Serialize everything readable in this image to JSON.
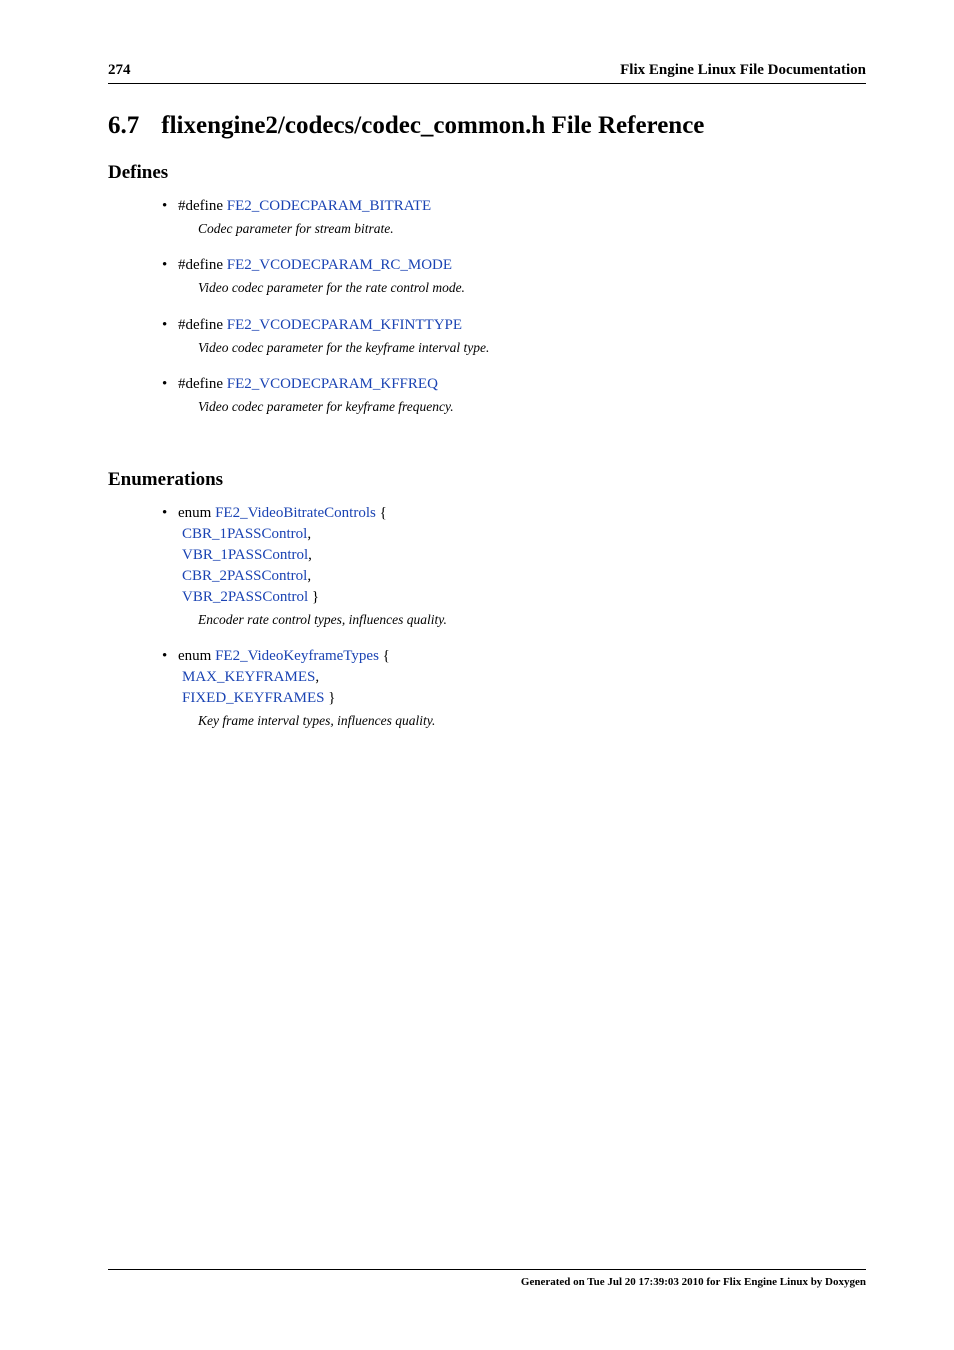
{
  "header": {
    "page_number": "274",
    "title": "Flix Engine Linux File Documentation"
  },
  "section": {
    "number": "6.7",
    "title": "flixengine2/codecs/codec_common.h File Reference"
  },
  "defines": {
    "heading": "Defines",
    "keyword": "#define",
    "items": [
      {
        "name": "FE2_CODECPARAM_BITRATE",
        "desc": "Codec parameter for stream bitrate."
      },
      {
        "name": "FE2_VCODECPARAM_RC_MODE",
        "desc": "Video codec parameter for the rate control mode."
      },
      {
        "name": "FE2_VCODECPARAM_KFINTTYPE",
        "desc": "Video codec parameter for the keyframe interval type."
      },
      {
        "name": "FE2_VCODECPARAM_KFFREQ",
        "desc": "Video codec parameter for keyframe frequency."
      }
    ]
  },
  "enums": {
    "heading": "Enumerations",
    "keyword": "enum",
    "items": [
      {
        "name": "FE2_VideoBitrateControls",
        "open": "{",
        "close": "}",
        "sep": ",",
        "members": [
          "CBR_1PASSControl",
          "VBR_1PASSControl",
          "CBR_2PASSControl",
          "VBR_2PASSControl"
        ],
        "desc": "Encoder rate control types, influences quality."
      },
      {
        "name": "FE2_VideoKeyframeTypes",
        "open": "{",
        "close": "}",
        "sep": ",",
        "members": [
          "MAX_KEYFRAMES",
          "FIXED_KEYFRAMES"
        ],
        "desc": "Key frame interval types, influences quality."
      }
    ]
  },
  "footer": {
    "text": "Generated on Tue Jul 20 17:39:03 2010 for Flix Engine Linux by Doxygen"
  }
}
